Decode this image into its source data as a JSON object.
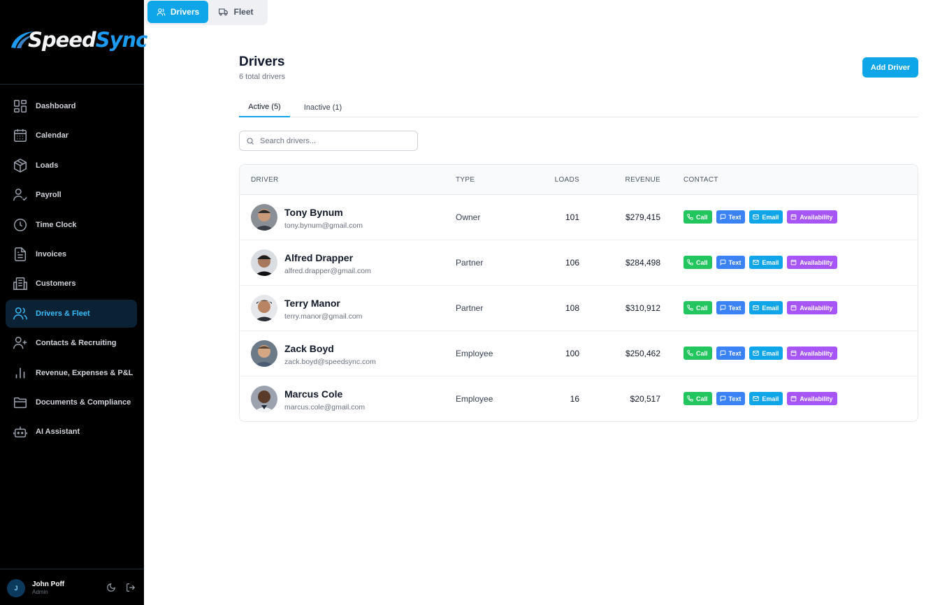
{
  "brand": {
    "speed": "Speed",
    "sync": "Sync"
  },
  "sidebar": {
    "items": [
      {
        "label": "Dashboard",
        "icon": "dashboard-icon"
      },
      {
        "label": "Calendar",
        "icon": "calendar-icon"
      },
      {
        "label": "Loads",
        "icon": "box-icon"
      },
      {
        "label": "Payroll",
        "icon": "user-check-icon"
      },
      {
        "label": "Time Clock",
        "icon": "clock-icon"
      },
      {
        "label": "Invoices",
        "icon": "file-icon"
      },
      {
        "label": "Customers",
        "icon": "building-icon"
      },
      {
        "label": "Drivers & Fleet",
        "icon": "users-icon",
        "active": true
      },
      {
        "label": "Contacts & Recruiting",
        "icon": "user-plus-icon"
      },
      {
        "label": "Revenue, Expenses & P&L",
        "icon": "bar-chart-icon"
      },
      {
        "label": "Documents & Compliance",
        "icon": "folder-icon"
      },
      {
        "label": "AI Assistant",
        "icon": "bot-icon"
      }
    ]
  },
  "user": {
    "initial": "J",
    "name": "John Poff",
    "role": "Admin"
  },
  "top_tabs": {
    "drivers": "Drivers",
    "fleet": "Fleet"
  },
  "page": {
    "title": "Drivers",
    "subtitle": "6 total drivers",
    "add_button": "Add Driver",
    "tab_active": "Active (5)",
    "tab_inactive": "Inactive (1)",
    "search_placeholder": "Search drivers..."
  },
  "table": {
    "headers": {
      "driver": "DRIVER",
      "type": "TYPE",
      "loads": "LOADS",
      "revenue": "REVENUE",
      "contact": "CONTACT"
    },
    "actions": {
      "call": "Call",
      "text": "Text",
      "email": "Email",
      "availability": "Availability"
    },
    "rows": [
      {
        "name": "Tony Bynum",
        "email": "tony.bynum@gmail.com",
        "type": "Owner",
        "loads": "101",
        "revenue": "$279,415"
      },
      {
        "name": "Alfred Drapper",
        "email": "alfred.drapper@gmail.com",
        "type": "Partner",
        "loads": "106",
        "revenue": "$284,498"
      },
      {
        "name": "Terry Manor",
        "email": "terry.manor@gmail.com",
        "type": "Partner",
        "loads": "108",
        "revenue": "$310,912"
      },
      {
        "name": "Zack Boyd",
        "email": "zack.boyd@speedsync.com",
        "type": "Employee",
        "loads": "100",
        "revenue": "$250,462"
      },
      {
        "name": "Marcus Cole",
        "email": "marcus.cole@gmail.com",
        "type": "Employee",
        "loads": "16",
        "revenue": "$20,517"
      }
    ]
  },
  "colors": {
    "accent": "#0ea5e9",
    "call": "#22c55e",
    "text": "#3b82f6",
    "email": "#0ea5e9",
    "availability": "#a855f7"
  }
}
